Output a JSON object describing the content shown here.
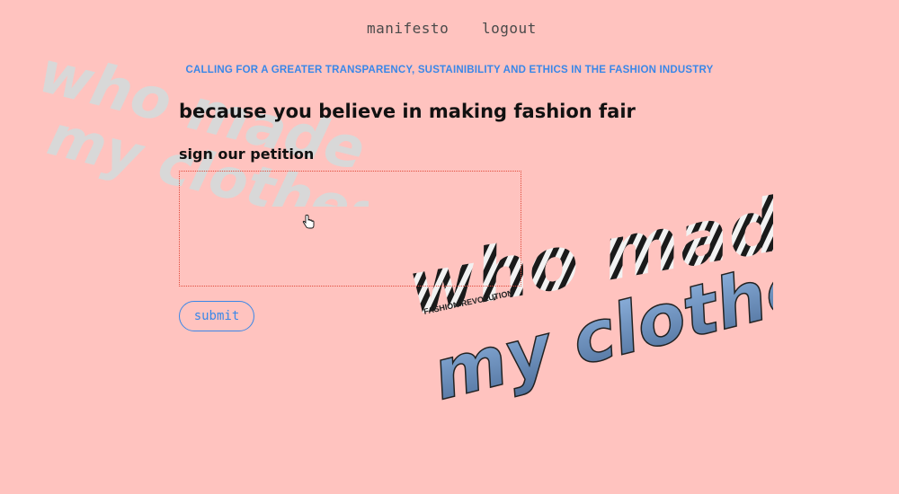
{
  "nav": {
    "manifesto_label": "manifesto",
    "logout_label": "logout"
  },
  "tagline": "CALLING FOR A GREATER TRANSPARENCY, SUSTAINIBILITY AND ETHICS IN THE FASHION INDUSTRY",
  "headline": "because you believe in making fashion fair",
  "petition": {
    "heading": "sign our petition",
    "value": "",
    "submit_label": "submit"
  },
  "watermark": {
    "line1": "who made",
    "line2": "my clothes?"
  },
  "collage": {
    "line1": "who made",
    "line2": "my clothes?",
    "badge": "FASHION REVOLUTION"
  },
  "colors": {
    "background": "#ffc3bf",
    "accent": "#3a87e8",
    "textarea_border": "#e04b3c",
    "watermark": "#d8d8d8",
    "collage_text": "#1a1a1a"
  },
  "icons": {
    "cursor": "hand-pointer-icon"
  }
}
